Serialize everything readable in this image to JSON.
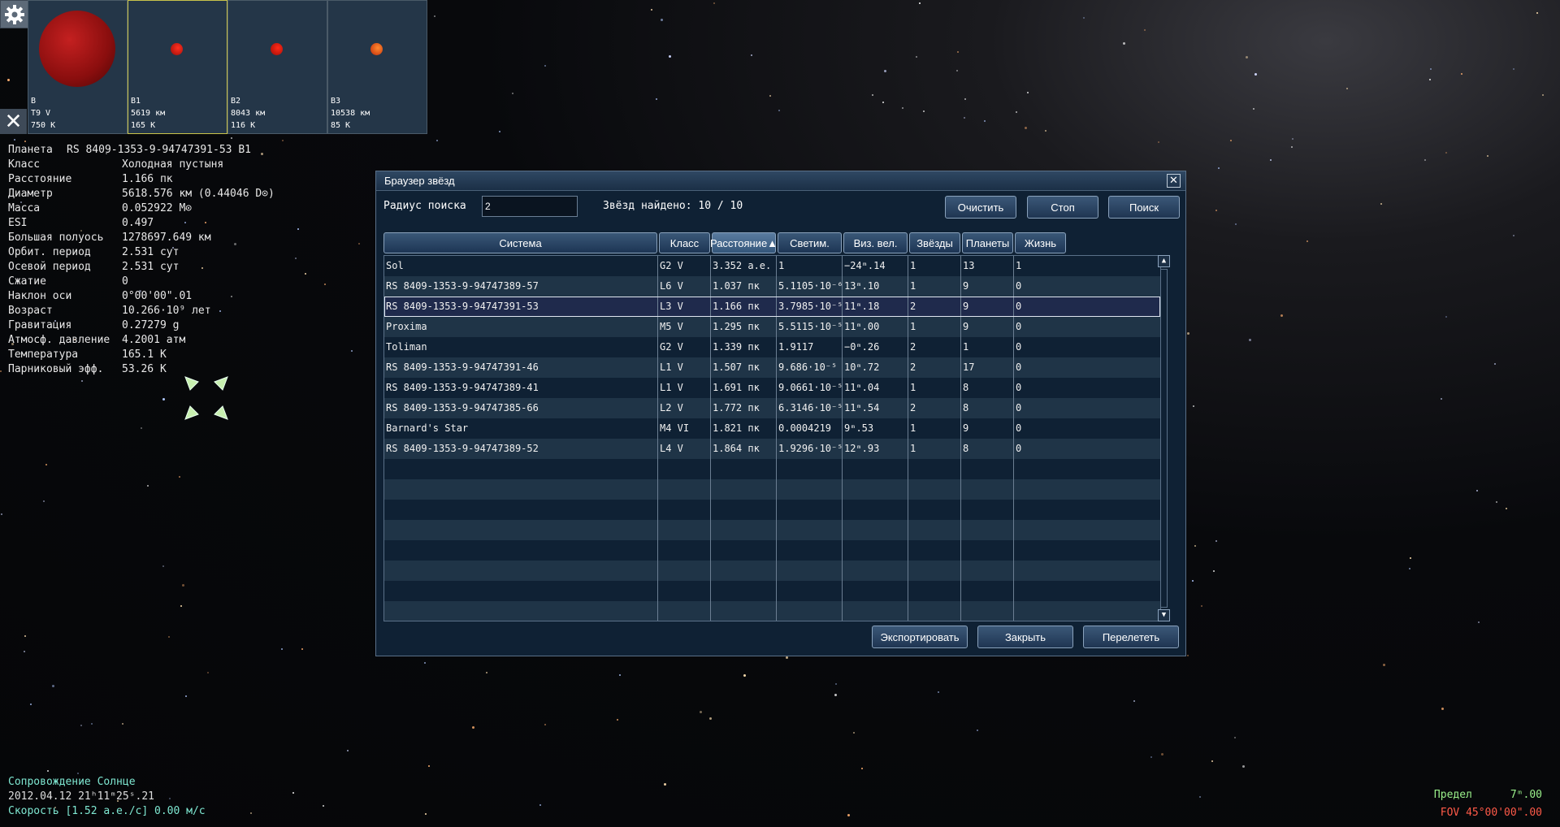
{
  "thumbnails": [
    {
      "name": "B",
      "type": "T9 V",
      "temp": "750 K",
      "color": "#a01414"
    },
    {
      "name": "B1",
      "type": "5619 км",
      "temp": "165 K",
      "color": "#cc1a10"
    },
    {
      "name": "B2",
      "type": "8043 км",
      "temp": "116 K",
      "color": "#d8200e"
    },
    {
      "name": "B3",
      "type": "10538 км",
      "temp": "85 K",
      "color": "#e84a14"
    }
  ],
  "planet_info": {
    "title_label": "Планета",
    "title_value": "RS 8409-1353-9-94747391-53 B1",
    "rows": [
      {
        "k": "Класс",
        "v": "Холодная пустыня"
      },
      {
        "k": "Расстояние",
        "v": "1.166 пк"
      },
      {
        "k": "Диаметр",
        "v": "5618.576 км (0.44046 D⊙)"
      },
      {
        "k": "Масса",
        "v": "0.052922 M⊙"
      },
      {
        "k": "ESI",
        "v": "0.497"
      },
      {
        "k": "Большая полуось",
        "v": "1278697.649 км"
      },
      {
        "k": "Орбит. период",
        "v": "2.531 сут"
      },
      {
        "k": "Осевой период",
        "v": "2.531 сут"
      },
      {
        "k": "Сжатие",
        "v": "0"
      },
      {
        "k": "Наклон оси",
        "v": "0°00'00\".01"
      },
      {
        "k": "Возраст",
        "v": "10.266·10⁹ лет"
      },
      {
        "k": "Гравитация",
        "v": "0.27279 g"
      },
      {
        "k": "Атмосф. давление",
        "v": "4.2001 атм"
      },
      {
        "k": "Температура",
        "v": "165.1 K"
      },
      {
        "k": "Парниковый эфф.",
        "v": "53.26 K"
      }
    ]
  },
  "status": {
    "follow": "Сопровождение Солнце",
    "datetime": "2012.04.12  21ʰ11ᵐ25ˢ.21",
    "speed": "Скорость [1.52 а.е./с] 0.00 м/с"
  },
  "bottom_right": {
    "limit_label": "Предел",
    "limit_value": "7ᵐ.00",
    "fov_label": "FOV",
    "fov_value": "45°00'00\".00"
  },
  "dialog": {
    "title": "Браузер звёзд",
    "radius_label": "Радиус поиска",
    "radius_value": "2",
    "found_label": "Звёзд найдено: 10 / 10",
    "btn_clear": "Очистить",
    "btn_stop": "Стоп",
    "btn_search": "Поиск",
    "btn_export": "Экспортировать",
    "btn_close": "Закрыть",
    "btn_goto": "Перелететь",
    "columns": [
      "Система",
      "Класс",
      "Расстояние▲",
      "Светим.",
      "Виз. вел.",
      "Звёзды",
      "Планеты",
      "Жизнь"
    ],
    "rows": [
      [
        "Sol",
        "G2 V",
        "3.352 а.е.",
        "1",
        "−24ᵐ.14",
        "1",
        "13",
        "1"
      ],
      [
        "RS 8409-1353-9-94747389-57",
        "L6 V",
        "1.037 пк",
        "5.1105·10⁻⁶",
        "13ᵐ.10",
        "1",
        "9",
        "0"
      ],
      [
        "RS 8409-1353-9-94747391-53",
        "L3 V",
        "1.166 пк",
        "3.7985·10⁻⁵",
        "11ᵐ.18",
        "2",
        "9",
        "0"
      ],
      [
        "Proxima",
        "M5 V",
        "1.295 пк",
        "5.5115·10⁻⁵",
        "11ᵐ.00",
        "1",
        "9",
        "0"
      ],
      [
        "Toliman",
        "G2 V",
        "1.339 пк",
        "1.9117",
        "−0ᵐ.26",
        "2",
        "1",
        "0"
      ],
      [
        "RS 8409-1353-9-94747391-46",
        "L1 V",
        "1.507 пк",
        "9.686·10⁻⁵",
        "10ᵐ.72",
        "2",
        "17",
        "0"
      ],
      [
        "RS 8409-1353-9-94747389-41",
        "L1 V",
        "1.691 пк",
        "9.0661·10⁻⁵",
        "11ᵐ.04",
        "1",
        "8",
        "0"
      ],
      [
        "RS 8409-1353-9-94747385-66",
        "L2 V",
        "1.772 пк",
        "6.3146·10⁻⁵",
        "11ᵐ.54",
        "2",
        "8",
        "0"
      ],
      [
        "Barnard's Star",
        "M4 VI",
        "1.821 пк",
        "0.0004219",
        "9ᵐ.53",
        "1",
        "9",
        "0"
      ],
      [
        "RS 8409-1353-9-94747389-52",
        "L4 V",
        "1.864 пк",
        "1.9296·10⁻⁵",
        "12ᵐ.93",
        "1",
        "8",
        "0"
      ]
    ],
    "selected_row": 2
  }
}
